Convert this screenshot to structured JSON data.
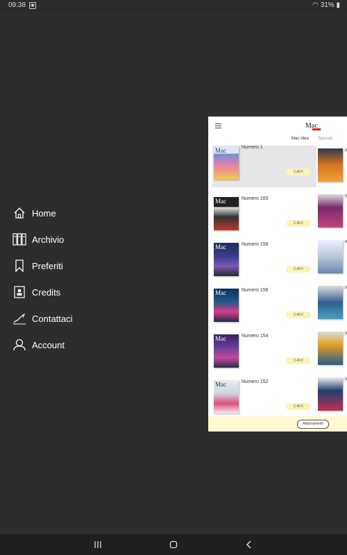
{
  "status": {
    "time": "09:38",
    "battery": "31%"
  },
  "menu": {
    "items": [
      {
        "label": "Home",
        "icon": "home-icon"
      },
      {
        "label": "Archivio",
        "icon": "archive-icon"
      },
      {
        "label": "Preferiti",
        "icon": "bookmark-icon"
      },
      {
        "label": "Credits",
        "icon": "credits-icon"
      },
      {
        "label": "Contattaci",
        "icon": "signature-icon"
      },
      {
        "label": "Account",
        "icon": "user-icon"
      }
    ]
  },
  "panel": {
    "logo": "Mac",
    "tabs": {
      "active": "Mac Idea",
      "inactive": "Speciali"
    },
    "issues": [
      {
        "title": "Numero 1",
        "price": "2,49 €",
        "cover_color": "#4a6fb5",
        "selected": true
      },
      {
        "title": "Numero 160",
        "price": "2,49 €",
        "cover_color": "#2a2a2a",
        "selected": false
      },
      {
        "title": "Numero 158",
        "price": "2,49 €",
        "cover_color": "#3b3b8a",
        "selected": false
      },
      {
        "title": "Numero 156",
        "price": "2,49 €",
        "cover_color": "#1f5a8a",
        "selected": false
      },
      {
        "title": "Numero 154",
        "price": "2,49 €",
        "cover_color": "#6a3fa0",
        "selected": false
      },
      {
        "title": "Numero 152",
        "price": "2,49 €",
        "cover_color": "#cfd5e0",
        "selected": false
      }
    ],
    "side_covers": [
      "#d9751e",
      "#7a2a6e",
      "#b7c7d8",
      "#2f5f8f",
      "#e0a020",
      "#1f3f6f"
    ],
    "side_titles": [
      "N",
      "N",
      "N",
      "N",
      "N",
      "N"
    ],
    "footer_button": "Abbonamenti"
  }
}
